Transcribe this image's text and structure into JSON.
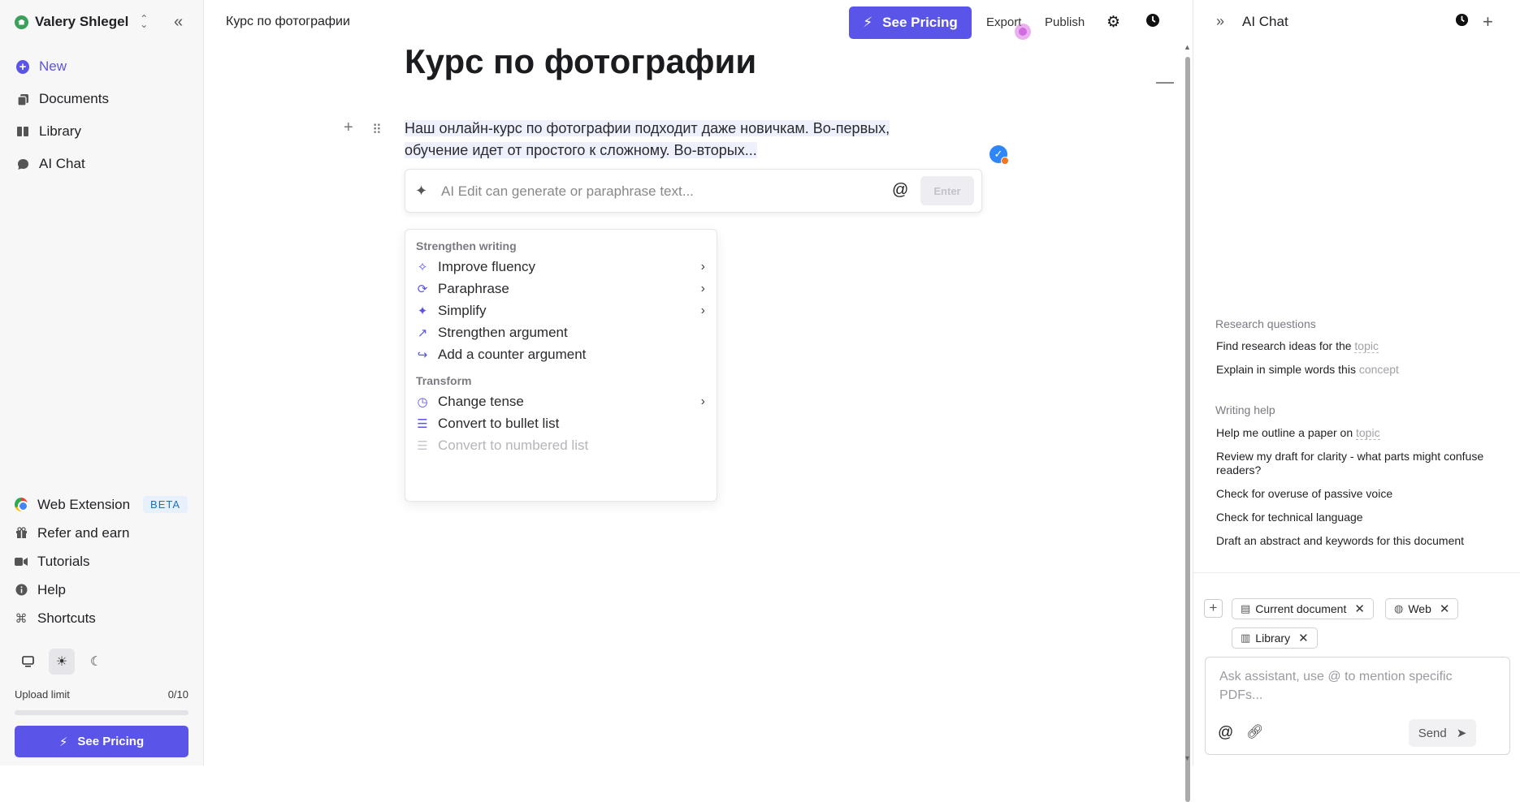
{
  "sidebar": {
    "user": {
      "name": "Valery Shlegel"
    },
    "nav": [
      {
        "label": "New"
      },
      {
        "label": "Documents"
      },
      {
        "label": "Library"
      },
      {
        "label": "AI Chat"
      }
    ],
    "bottom_nav": [
      {
        "label": "Web Extension",
        "badge": "BETA"
      },
      {
        "label": "Refer and earn"
      },
      {
        "label": "Tutorials"
      },
      {
        "label": "Help"
      },
      {
        "label": "Shortcuts"
      }
    ],
    "upload": {
      "label": "Upload limit",
      "count": "0/10",
      "fraction": 0
    },
    "cta_label": "See Pricing"
  },
  "topbar": {
    "crumb": "Курс по фотографии",
    "cta_label": "See Pricing",
    "export_label": "Export",
    "publish_label": "Publish"
  },
  "editor": {
    "title": "Курс по фотографии",
    "paragraph_line1": "Наш онлайн-курс по фотографии подходит даже новичкам. Во-первых,",
    "paragraph_line2": "обучение идет от простого к сложному. Во-вторых...",
    "ai_edit": {
      "placeholder": "AI Edit can generate or paraphrase text...",
      "enter_label": "Enter"
    },
    "menu": {
      "section1": "Strengthen writing",
      "items1": [
        "Improve fluency",
        "Paraphrase",
        "Simplify",
        "Strengthen argument",
        "Add a counter argument"
      ],
      "section2": "Transform",
      "items2": [
        "Change tense",
        "Convert to bullet list",
        "Convert to numbered list"
      ]
    }
  },
  "right_panel": {
    "title": "AI Chat",
    "research": {
      "heading": "Research questions",
      "items": [
        {
          "text": "Find research ideas for the",
          "placeholder": "topic"
        },
        {
          "text": "Explain in simple words this",
          "placeholder": "concept"
        }
      ]
    },
    "writing": {
      "heading": "Writing help",
      "item1_text": "Help me outline a paper on",
      "item1_placeholder": "topic",
      "item2": "Review my draft for clarity - what parts might confuse readers?",
      "item3": "Check for overuse of passive voice",
      "item4": "Check for technical language",
      "item5": "Draft an abstract and keywords for this document"
    },
    "chips": [
      "Current document",
      "Web",
      "Library"
    ],
    "composer": {
      "placeholder": "Ask assistant, use @ to mention specific PDFs...",
      "send_label": "Send"
    }
  },
  "colors": {
    "accent": "#5b54e8",
    "sidebar_bg": "#f7f7f8",
    "check_badge": "#2f86f6"
  }
}
